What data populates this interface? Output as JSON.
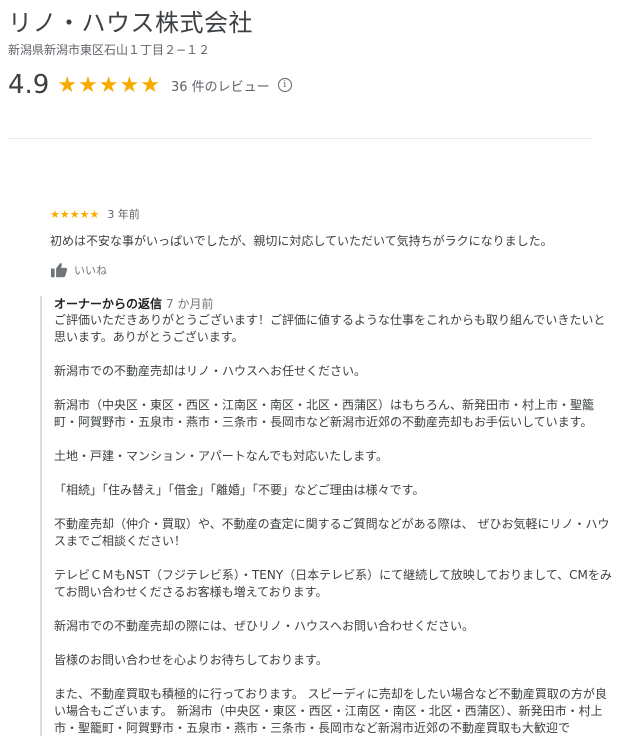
{
  "business": {
    "name": "リノ・ハウス株式会社",
    "address": "新潟県新潟市東区石山１丁目２−１２",
    "rating": "4.9",
    "stars": "★★★★★",
    "review_count": "36 件のレビュー",
    "info_icon": "i"
  },
  "review": {
    "stars": "★★★★★",
    "time": "3 年前",
    "text": "初めは不安な事がいっぱいでしたが、親切に対応していただいて気持ちがラクになりました。",
    "like_label": "いいね"
  },
  "owner_reply": {
    "label": "オーナーからの返信",
    "time": "7 か月前",
    "paragraphs": [
      "ご評価いただきありがとうございます！ご評価に値するような仕事をこれからも取り組んでいきたいと思います。ありがとうございます。",
      "新潟市での不動産売却はリノ・ハウスへお任せください。",
      "新潟市（中央区・東区・西区・江南区・南区・北区・西蒲区）はもちろん、新発田市・村上市・聖籠町・阿賀野市・五泉市・燕市・三条市・長岡市など新潟市近郊の不動産売却もお手伝いしています。",
      "土地・戸建・マンション・アパートなんでも対応いたします。",
      "「相続」「住み替え」「借金」「離婚」「不要」などご理由は様々です。",
      "不動産売却（仲介・買取）や、不動産の査定に関するご質問などがある際は、 ぜひお気軽にリノ・ハウスまでご相談ください！",
      "テレビＣＭもNST（フジテレビ系）・TENY（日本テレビ系）にて継続して放映しておりまして、CMをみてお問い合わせくださるお客様も増えております。",
      "新潟市での不動産売却の際には、ぜひリノ・ハウスへお問い合わせください。",
      "皆様のお問い合わせを心よりお待ちしております。",
      "また、不動産買取も積極的に行っております。 スピーディに売却をしたい場合など不動産買取の方が良い場合もございます。 新潟市（中央区・東区・西区・江南区・南区・北区・西蒲区）、新発田市・村上市・聖籠町・阿賀野市・五泉市・燕市・三条市・長岡市など新潟市近郊の不動産買取も大歓迎で"
    ]
  }
}
